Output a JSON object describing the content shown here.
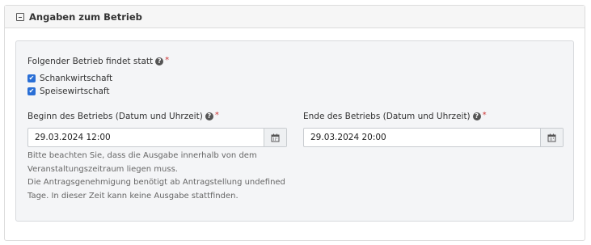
{
  "panel": {
    "title": "Angaben zum Betrieb"
  },
  "betrieb": {
    "label": "Folgender Betrieb findet statt",
    "options": [
      {
        "label": "Schankwirtschaft",
        "checked": true
      },
      {
        "label": "Speisewirtschaft",
        "checked": true
      }
    ]
  },
  "beginn": {
    "label": "Beginn des Betriebs (Datum und Uhrzeit)",
    "value": "29.03.2024 12:00"
  },
  "ende": {
    "label": "Ende des Betriebs (Datum und Uhrzeit)",
    "value": "29.03.2024 20:00"
  },
  "hints": [
    "Bitte beachten Sie, dass die Ausgabe innerhalb von dem",
    "Veranstaltungszeitraum liegen muss.",
    "Die Antragsgenehmigung benötigt ab Antragstellung undefined",
    "Tage. In dieser Zeit kann keine Ausgabe stattfinden."
  ],
  "required_marker": "*",
  "help_glyph": "?",
  "icons": {
    "collapse": "minus-square-icon",
    "help": "question-circle-icon",
    "calendar": "calendar-icon"
  },
  "colors": {
    "checkbox": "#2a6fd6",
    "required": "#cc3333"
  }
}
